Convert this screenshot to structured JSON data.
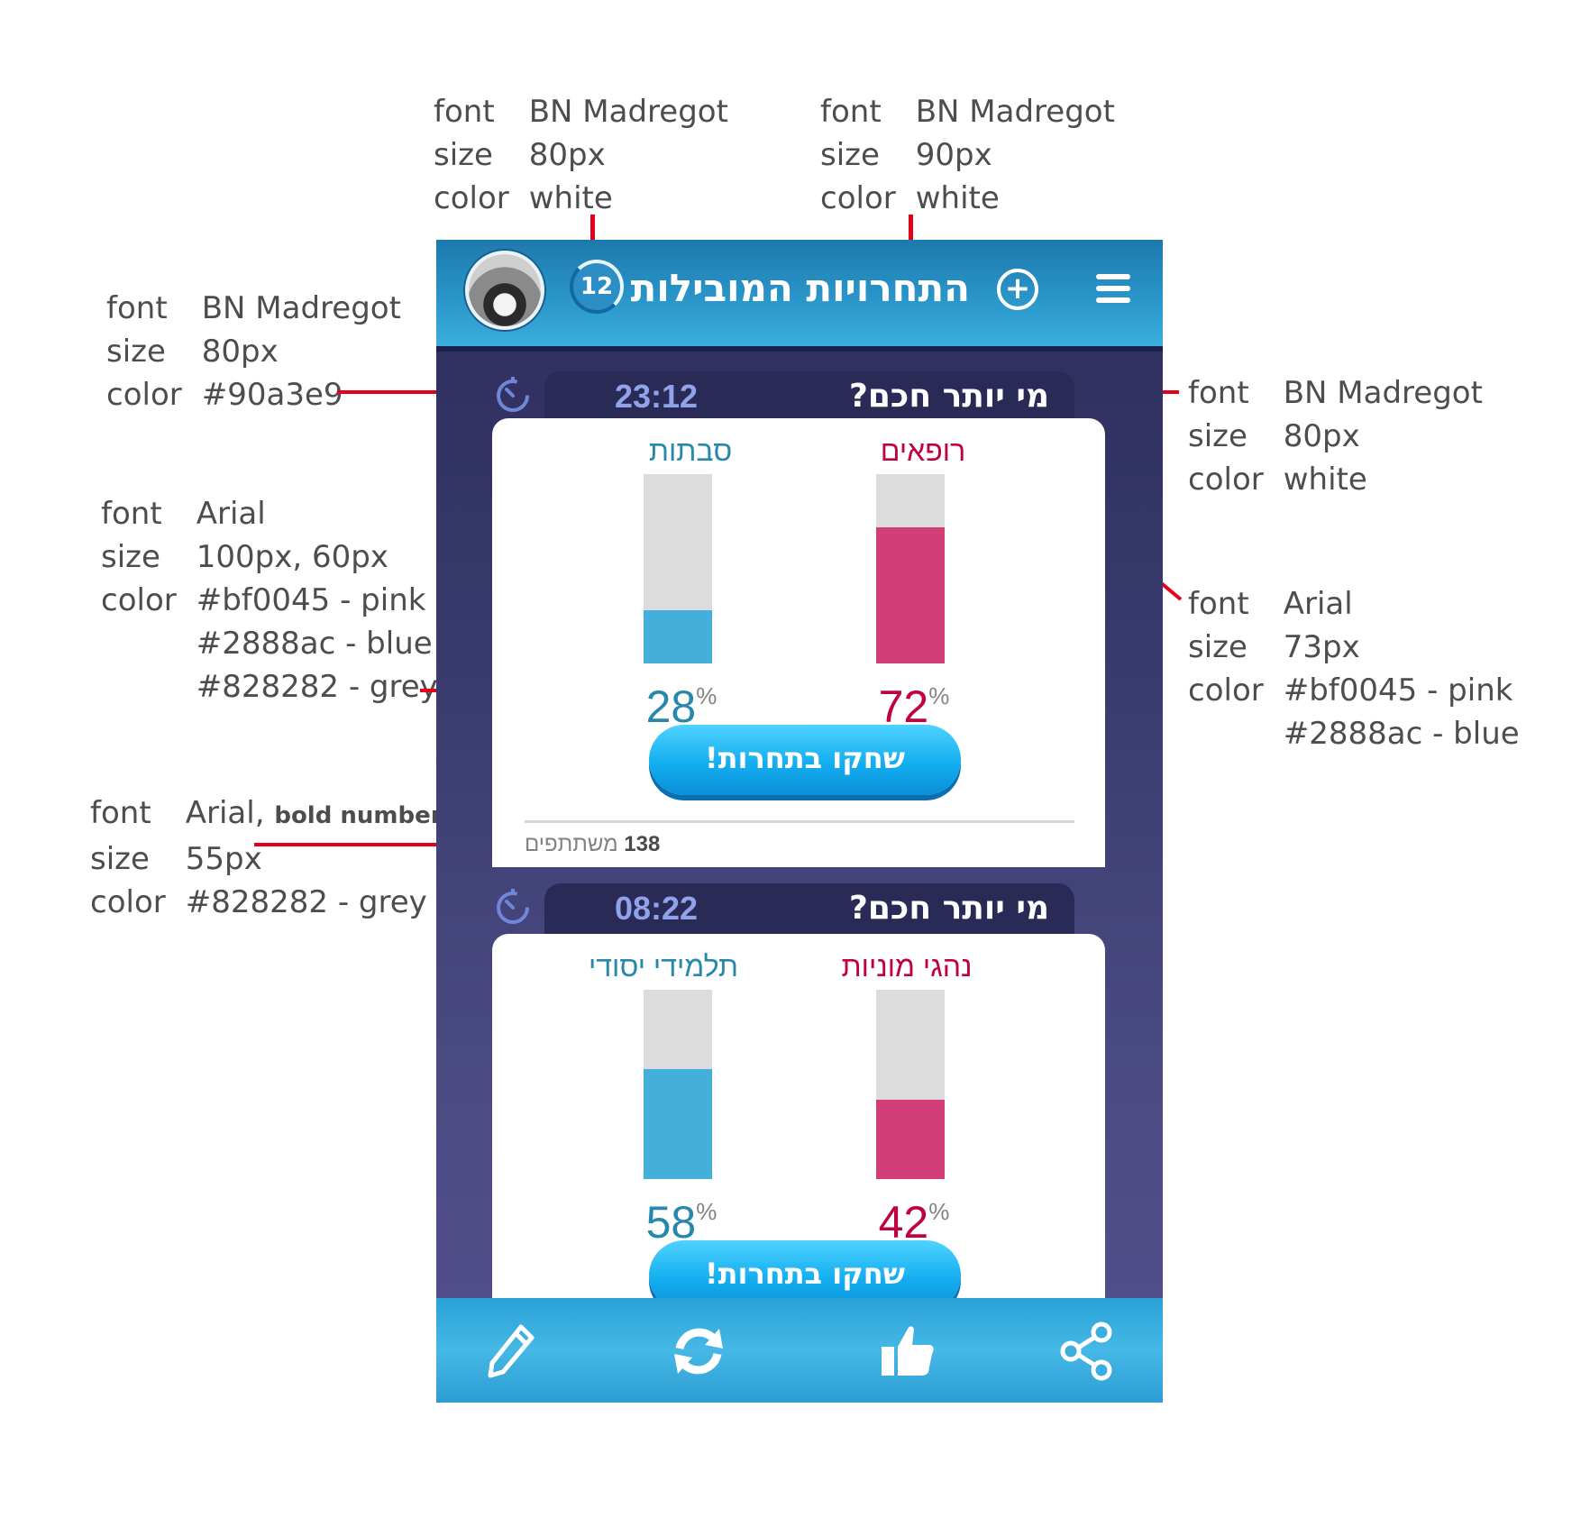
{
  "specs": {
    "level_badge": {
      "font_label": "font",
      "font": "BN Madregot",
      "size_label": "size",
      "size": "80px",
      "color_label": "color",
      "color": "white"
    },
    "app_title": {
      "font_label": "font",
      "font": "BN Madregot",
      "size_label": "size",
      "size": "90px",
      "color_label": "color",
      "color": "white"
    },
    "timer": {
      "font_label": "font",
      "font": "BN Madregot",
      "size_label": "size",
      "size": "80px",
      "color_label": "color",
      "color": "#90a3e9"
    },
    "challenge_title": {
      "font_label": "font",
      "font": "BN Madregot",
      "size_label": "size",
      "size": "80px",
      "color_label": "color",
      "color": "white"
    },
    "percent": {
      "font_label": "font",
      "font": "Arial",
      "size_label": "size",
      "size": "100px, 60px",
      "color_label": "color",
      "color_1": "#bf0045 - pink",
      "color_2": "#2888ac - blue",
      "color_3": "#828282 - grey"
    },
    "team_name": {
      "font_label": "font",
      "font": "Arial",
      "size_label": "size",
      "size": "73px",
      "color_label": "color",
      "color_1": "#bf0045 - pink",
      "color_2": "#2888ac - blue"
    },
    "participants": {
      "font_label": "font",
      "font": "Arial,",
      "font_note": "bold number",
      "size_label": "size",
      "size": "55px",
      "color_label": "color",
      "color": "#828282 - grey"
    }
  },
  "colors": {
    "pink": "#bf0045",
    "blue": "#2888ac",
    "grey": "#828282",
    "timer": "#90a3e9",
    "lead_line": "#e3001b"
  },
  "header": {
    "avatar_icon": "user-avatar",
    "level": "12",
    "title": "התחרויות המובילות",
    "plus_icon": "plus-circle-icon",
    "menu_icon": "hamburger-icon"
  },
  "challenges": [
    {
      "title": "מי יותר חכם?",
      "time": "23:12",
      "team_left": {
        "name": "סבתות",
        "percent": 28,
        "percent_text": "28",
        "color": "blue"
      },
      "team_right": {
        "name": "רופאים",
        "percent": 72,
        "percent_text": "72",
        "color": "pink"
      },
      "percent_sign": "%",
      "play_label": "שחקו בתחרות!",
      "participants_count": "138",
      "participants_label": "משתתפים"
    },
    {
      "title": "מי יותר חכם?",
      "time": "08:22",
      "team_left": {
        "name": "תלמידי יסודי",
        "percent": 58,
        "percent_text": "58",
        "color": "blue"
      },
      "team_right": {
        "name": "נהגי מוניות",
        "percent": 42,
        "percent_text": "42",
        "color": "pink"
      },
      "percent_sign": "%",
      "play_label": "שחקו בתחרות!"
    }
  ],
  "bottom_bar": [
    "pencil-icon",
    "refresh-icon",
    "thumbs-up-icon",
    "share-icon"
  ]
}
